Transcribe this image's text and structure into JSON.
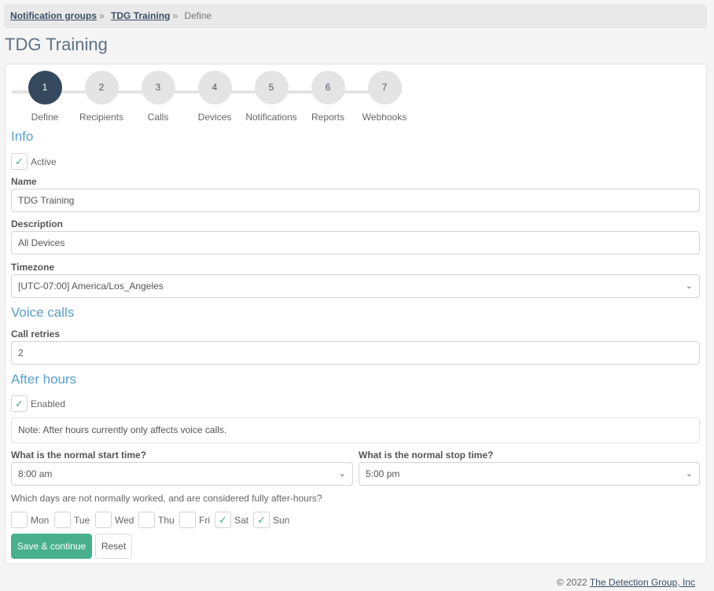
{
  "breadcrumb": {
    "items": [
      "Notification groups",
      "TDG Training"
    ],
    "separator": "»",
    "current": "Define"
  },
  "page_title": "TDG Training",
  "steps": [
    {
      "number": "1",
      "label": "Define",
      "active": true
    },
    {
      "number": "2",
      "label": "Recipients",
      "active": false
    },
    {
      "number": "3",
      "label": "Calls",
      "active": false
    },
    {
      "number": "4",
      "label": "Devices",
      "active": false
    },
    {
      "number": "5",
      "label": "Notifications",
      "active": false
    },
    {
      "number": "6",
      "label": "Reports",
      "active": false
    },
    {
      "number": "7",
      "label": "Webhooks",
      "active": false
    }
  ],
  "info": {
    "title": "Info",
    "active": {
      "label": "Active",
      "checked": true
    },
    "name": {
      "label": "Name",
      "value": "TDG Training"
    },
    "description": {
      "label": "Description",
      "value": "All Devices"
    },
    "timezone": {
      "label": "Timezone",
      "value": "[UTC-07:00] America/Los_Angeles"
    }
  },
  "voice_calls": {
    "title": "Voice calls",
    "call_retries": {
      "label": "Call retries",
      "value": "2"
    }
  },
  "after_hours": {
    "title": "After hours",
    "enabled": {
      "label": "Enabled",
      "checked": true
    },
    "note": "Note: After hours currently only affects voice calls.",
    "start_time": {
      "label": "What is the normal start time?",
      "value": "8:00 am"
    },
    "stop_time": {
      "label": "What is the normal stop time?",
      "value": "5:00 pm"
    },
    "days_question": "Which days are not normally worked, and are considered fully after-hours?",
    "days": [
      {
        "label": "Mon",
        "checked": false
      },
      {
        "label": "Tue",
        "checked": false
      },
      {
        "label": "Wed",
        "checked": false
      },
      {
        "label": "Thu",
        "checked": false
      },
      {
        "label": "Fri",
        "checked": false
      },
      {
        "label": "Sat",
        "checked": true
      },
      {
        "label": "Sun",
        "checked": true
      }
    ]
  },
  "buttons": {
    "save": "Save & continue",
    "reset": "Reset"
  },
  "footer": {
    "copyright": "© 2022",
    "company": "The Detection Group, Inc"
  },
  "icons": {
    "check": "checkmark-icon",
    "select_arrow": "chevron-down-icon"
  },
  "colors": {
    "accent": "#48b08c",
    "section_title": "#5aa0c8",
    "step_active": "#34495e",
    "step_inactive": "#e4e4e4"
  }
}
